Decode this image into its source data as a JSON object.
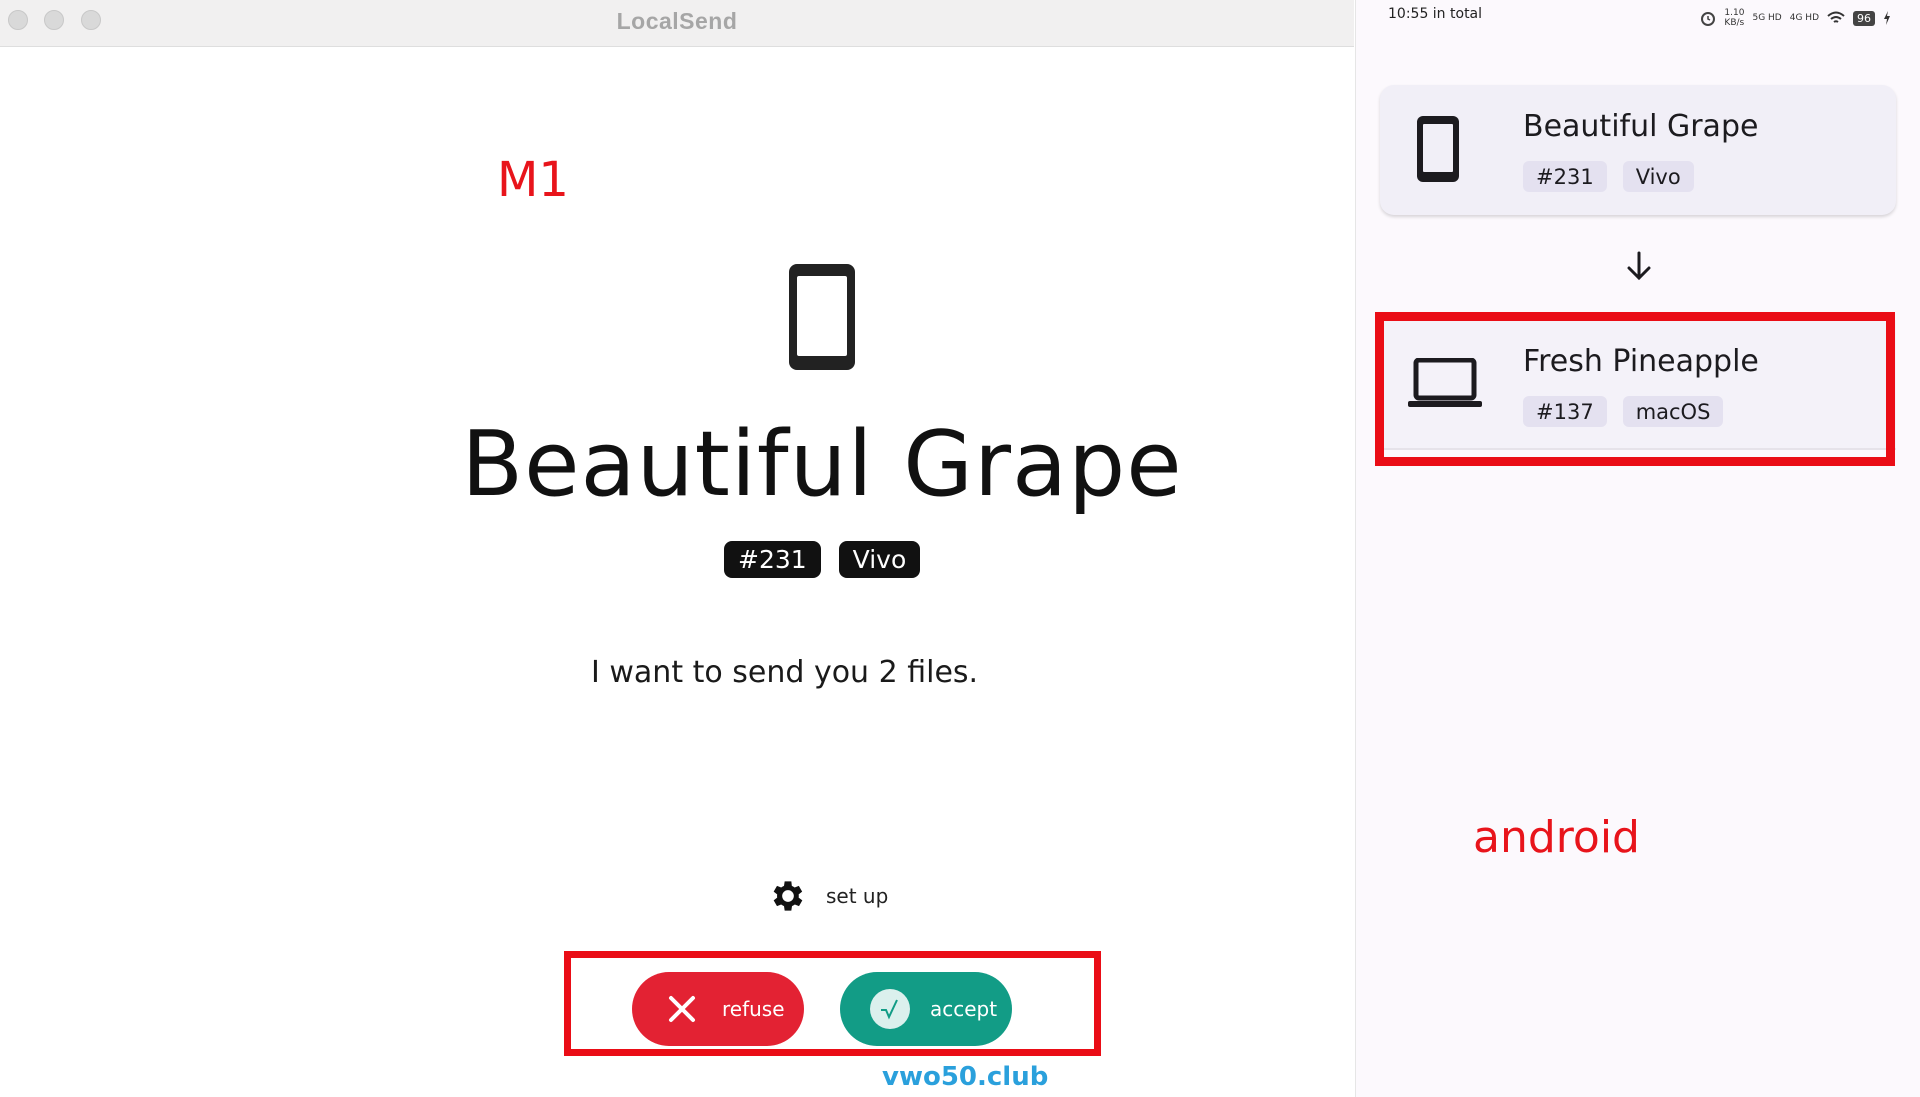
{
  "mac_window": {
    "title": "LocalSend",
    "annotation": "M1",
    "sender": {
      "name": "Beautiful Grape",
      "tags": [
        "#231",
        "Vivo"
      ],
      "device_icon": "smartphone-icon"
    },
    "message": "I want to send you 2 files.",
    "setup": {
      "label": "set up",
      "icon": "gear-icon"
    },
    "actions": {
      "refuse_label": "refuse",
      "accept_label": "accept"
    },
    "watermark": "vwo50.club"
  },
  "android": {
    "status_bar": {
      "time": "10:55 in total",
      "speed": "1.10",
      "speed_unit": "KB/s",
      "net1": "5G HD",
      "net2": "4G HD",
      "battery": "96"
    },
    "from_device": {
      "name": "Beautiful Grape",
      "tags": [
        "#231",
        "Vivo"
      ],
      "icon": "smartphone-icon"
    },
    "to_device": {
      "name": "Fresh Pineapple",
      "tags": [
        "#137",
        "macOS"
      ],
      "icon": "laptop-icon"
    },
    "annotation": "android"
  },
  "colors": {
    "refuse": "#e32233",
    "accept": "#129c86",
    "annotation_red": "#e8141b",
    "watermark": "#2aa0dc"
  }
}
